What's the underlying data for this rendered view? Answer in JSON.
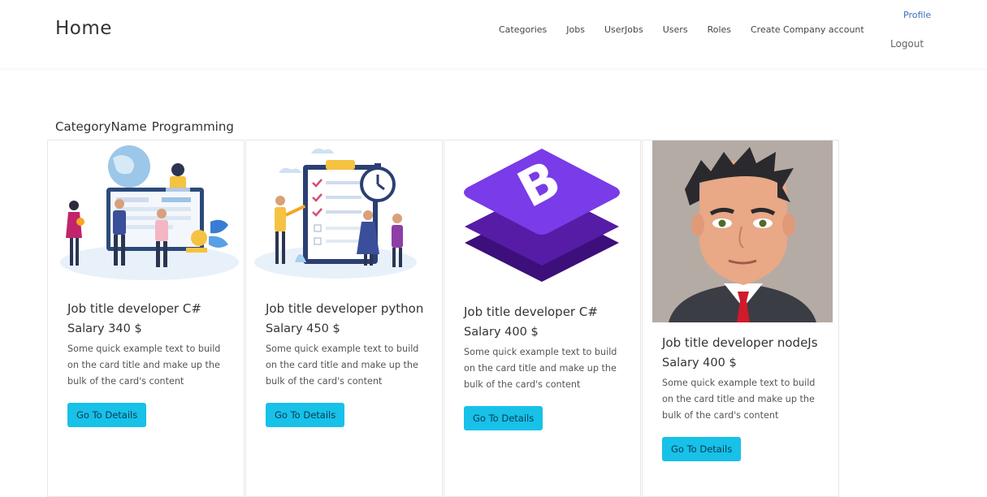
{
  "navbar": {
    "brand": "Home",
    "links": [
      "Categories",
      "Jobs",
      "UserJobs",
      "Users",
      "Roles",
      "Create Company account"
    ],
    "profile": "Profile",
    "logout": "Logout"
  },
  "category": {
    "label": "CategoryName",
    "name": "Programming"
  },
  "cards": [
    {
      "title": "Job title developer C#",
      "salary": "Salary 340 $",
      "text": "Some quick example text to build on the card title and make up the bulk of the card's content",
      "button": "Go To Details",
      "image": "team-workspace-illustration"
    },
    {
      "title": "Job title developer python",
      "salary": "Salary 450 $",
      "text": "Some quick example text to build on the card title and make up the bulk of the card's content",
      "button": "Go To Details",
      "image": "checklist-illustration"
    },
    {
      "title": "Job title developer C#",
      "salary": "Salary 400 $",
      "text": "Some quick example text to build on the card title and make up the bulk of the card's content",
      "button": "Go To Details",
      "image": "bootstrap-logo"
    },
    {
      "title": "Job title developer nodeJs",
      "salary": "Salary 400 $",
      "text": "Some quick example text to build on the card title and make up the bulk of the card's content",
      "button": "Go To Details",
      "image": "man-avatar"
    }
  ],
  "colors": {
    "button": "#17c1e8",
    "bootstrap_purple": "#6f2bd9",
    "profile_link": "#3b6fb6"
  }
}
